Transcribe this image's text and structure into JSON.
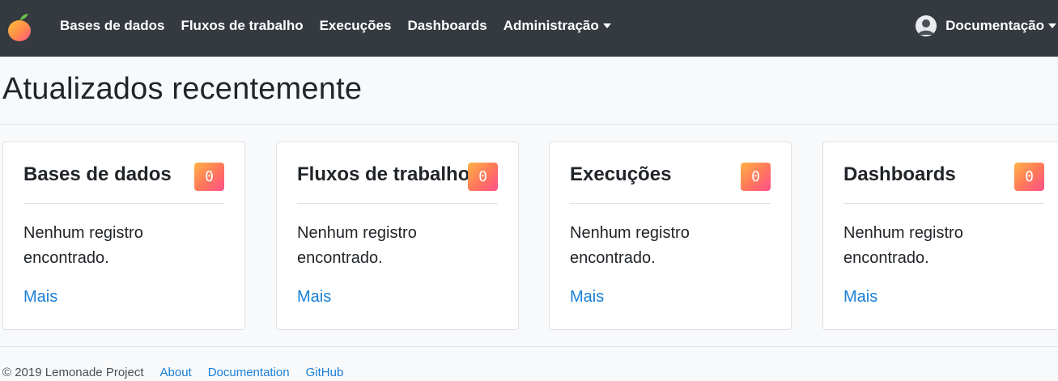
{
  "navbar": {
    "items": [
      {
        "label": "Bases de dados"
      },
      {
        "label": "Fluxos de trabalho"
      },
      {
        "label": "Execuções"
      },
      {
        "label": "Dashboards"
      },
      {
        "label": "Administração"
      }
    ],
    "user_menu_label": "Documentação"
  },
  "page": {
    "title": "Atualizados recentemente"
  },
  "cards": [
    {
      "title": "Bases de dados",
      "count": "0",
      "message": "Nenhum registro encontrado.",
      "link": "Mais"
    },
    {
      "title": "Fluxos de trabalho",
      "count": "0",
      "message": "Nenhum registro encontrado.",
      "link": "Mais"
    },
    {
      "title": "Execuções",
      "count": "0",
      "message": "Nenhum registro encontrado.",
      "link": "Mais"
    },
    {
      "title": "Dashboards",
      "count": "0",
      "message": "Nenhum registro encontrado.",
      "link": "Mais"
    }
  ],
  "footer": {
    "copyright": "© 2019 Lemonade Project",
    "links": [
      "About",
      "Documentation",
      "GitHub"
    ]
  },
  "colors": {
    "navbar_bg": "#343a40",
    "link": "#1a7fd6",
    "badge_gradient_start": "#ffb347",
    "badge_gradient_end": "#ff4f8b"
  }
}
